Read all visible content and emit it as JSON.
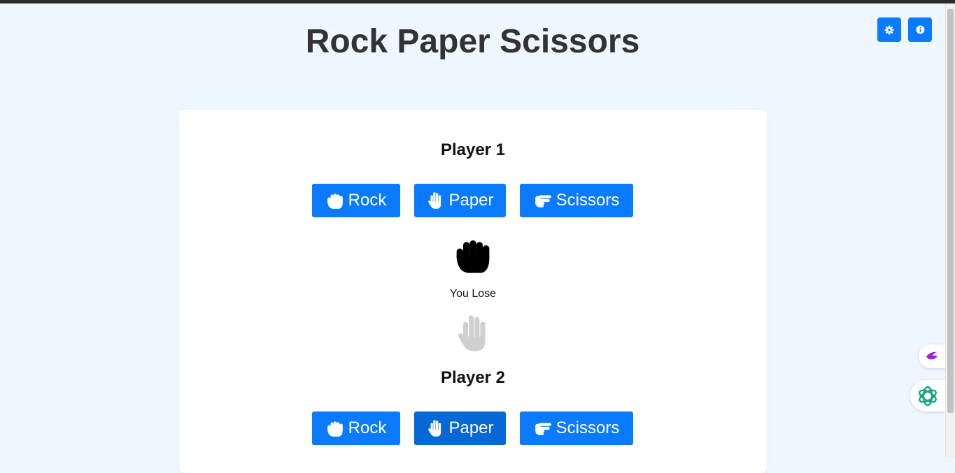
{
  "page": {
    "title": "Rock Paper Scissors"
  },
  "toolbar": {
    "settings_icon": "gear-icon",
    "info_icon": "info-icon"
  },
  "colors": {
    "accent": "#0a7bff",
    "background": "#eef6ff"
  },
  "player1": {
    "title": "Player 1",
    "buttons": [
      {
        "label": "Rock",
        "icon": "rock-hand-icon"
      },
      {
        "label": "Paper",
        "icon": "paper-hand-icon"
      },
      {
        "label": "Scissors",
        "icon": "scissors-hand-icon"
      }
    ],
    "selected_icon": "rock-hand-icon"
  },
  "result": {
    "text": "You Lose"
  },
  "player2": {
    "title": "Player 2",
    "buttons": [
      {
        "label": "Rock",
        "icon": "rock-hand-icon"
      },
      {
        "label": "Paper",
        "icon": "paper-hand-icon"
      },
      {
        "label": "Scissors",
        "icon": "scissors-hand-icon"
      }
    ],
    "selected_icon": "paper-hand-icon"
  }
}
